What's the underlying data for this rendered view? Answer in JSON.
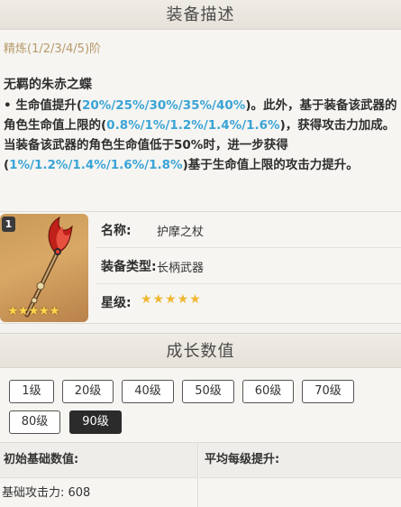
{
  "headers": {
    "description": "装备描述",
    "growth": "成长数值"
  },
  "refinement": {
    "label": "精炼(1/2/3/4/5)阶"
  },
  "passive": {
    "name": "无羁的朱赤之蝶",
    "bullet": "•",
    "t1": "生命值提升(",
    "hp_values": "20%/25%/30%/35%/40%",
    "t2": ")。此外，基于装备该武器的角色生命值上限的(",
    "atk_values": "0.8%/1%/1.2%/1.4%/1.6%",
    "t3": ")，获得攻击力加成。当装备该武器的角色生命值低于50%时，进一步获得(",
    "atk_values_2": "1%/1.2%/1.4%/1.6%/1.8%",
    "t4": ")基于生命值上限的攻击力提升。"
  },
  "weapon": {
    "refine_level": "1",
    "image_stars": "★★★★★",
    "name_label": "名称:",
    "name": "护摩之杖",
    "type_label": "装备类型:",
    "type": "长柄武器",
    "rarity_label": "星级:",
    "rarity_stars": "★★★★★",
    "rarity": 5
  },
  "levels": [
    "1级",
    "20级",
    "40级",
    "50级",
    "60级",
    "70级",
    "80级",
    "90级"
  ],
  "selected_level": "90级",
  "stats_table": {
    "col_initial": "初始基础数值:",
    "col_avg": "平均每级提升:",
    "row_initial": "基础攻击力: 608",
    "row_avg": ""
  },
  "colors": {
    "highlight": "#3aa4d6",
    "refine_text": "#b89a6a",
    "active_button": "#2b2b2b",
    "star": "#f0b730"
  }
}
